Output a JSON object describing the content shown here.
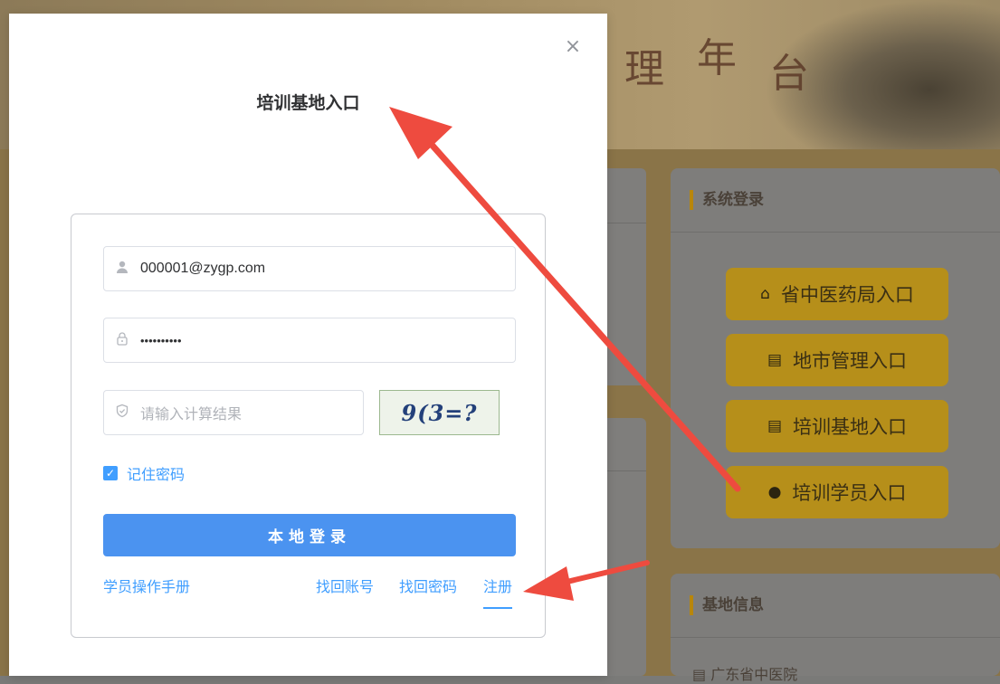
{
  "modal": {
    "title": "培训基地入口",
    "close_glyph": "×",
    "username_value": "000001@zygp.com",
    "password_mask": "••••••••••",
    "captcha_placeholder": "请输入计算结果",
    "captcha_text": "9(3=?",
    "remember_label": "记住密码",
    "login_button": "本地登录",
    "links": {
      "manual": "学员操作手册",
      "find_account": "找回账号",
      "find_password": "找回密码",
      "register": "注册"
    }
  },
  "background": {
    "banner_chars": [
      "理",
      "年",
      "台"
    ],
    "login_panel": {
      "title": "系统登录",
      "entries": [
        {
          "label": "省中医药局入口",
          "icon": "home-icon"
        },
        {
          "label": "地市管理入口",
          "icon": "building-icon"
        },
        {
          "label": "培训基地入口",
          "icon": "building-icon"
        },
        {
          "label": "培训学员入口",
          "icon": "user-icon"
        }
      ]
    },
    "info_panel": {
      "title": "基地信息",
      "first_item": "广东省中医院"
    }
  },
  "colors": {
    "primary": "#409eff",
    "login_button": "#4b93f0",
    "entry_button": "#b68f1a",
    "arrow": "#ee4b3f"
  }
}
